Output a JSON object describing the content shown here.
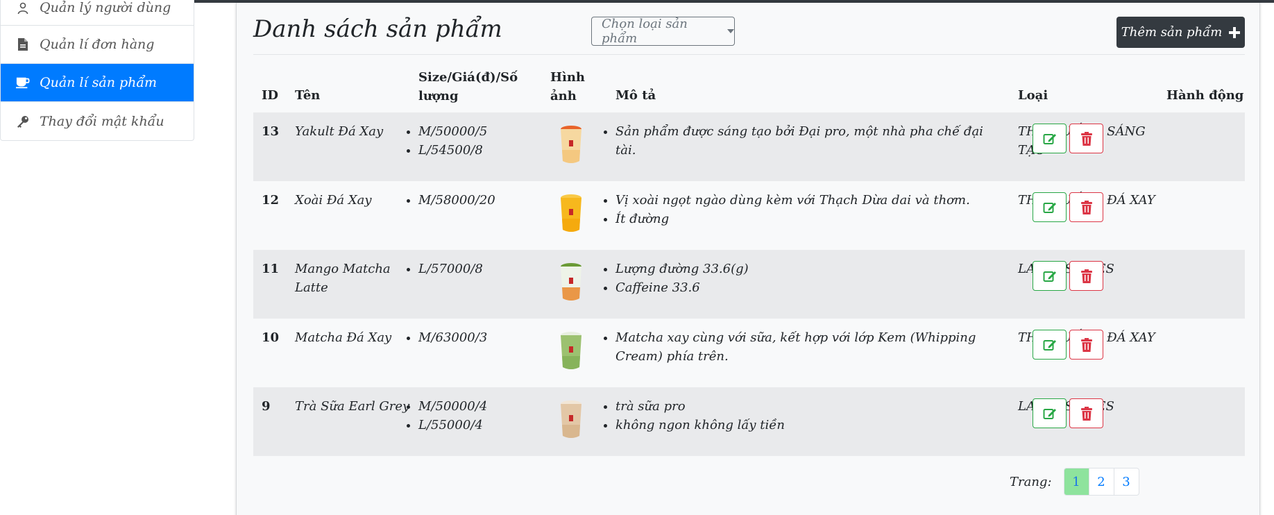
{
  "sidebar": {
    "items": [
      {
        "label": "Quản lý người dùng",
        "icon": "user-icon"
      },
      {
        "label": "Quản lí đơn hàng",
        "icon": "file-icon"
      },
      {
        "label": "Quản lí sản phẩm",
        "icon": "coffee-cup-icon"
      },
      {
        "label": "Thay đổi mật khẩu",
        "icon": "key-icon"
      }
    ]
  },
  "main": {
    "title": "Danh sách sản phẩm",
    "category_placeholder": "Chọn loại sản phẩm",
    "add_button_label": "Thêm sản phẩm"
  },
  "table": {
    "headers": {
      "id": "ID",
      "name": "Tên",
      "size_line1": "Size/Giá(đ)/Số",
      "size_line2": "lượng",
      "image_line1": "Hình",
      "image_line2": "ảnh",
      "description": "Mô tả",
      "category": "Loại",
      "actions": "Hành động"
    },
    "rows": [
      {
        "id": "13",
        "name": "Yakult Đá Xay",
        "sizes": [
          "M/50000/5",
          "L/54500/8"
        ],
        "desc": [
          "Sản phẩm được sáng tạo bởi Đại pro, một nhà pha chế đại tài."
        ],
        "category": "THỨC UỐNG SÁNG TẠO",
        "drink": "yakult"
      },
      {
        "id": "12",
        "name": "Xoài Đá Xay",
        "sizes": [
          "M/58000/20"
        ],
        "desc": [
          "Vị xoài ngọt ngào dùng kèm với Thạch Dừa dai và thơm.",
          "Ít đường"
        ],
        "category": "THỨC UỐNG ĐÁ XAY",
        "drink": "mango"
      },
      {
        "id": "11",
        "name": "Mango Matcha Latte",
        "sizes": [
          "L/57000/8"
        ],
        "desc": [
          "Lượng đường 33.6(g)",
          "Caffeine 33.6"
        ],
        "category": "LATTE SERIES",
        "drink": "mango-matcha"
      },
      {
        "id": "10",
        "name": "Matcha Đá Xay",
        "sizes": [
          "M/63000/3"
        ],
        "desc": [
          "Matcha xay cùng với sữa, kết hợp với lớp Kem (Whipping Cream) phía trên."
        ],
        "category": "THỨC UỐNG ĐÁ XAY",
        "drink": "matcha"
      },
      {
        "id": "9",
        "name": "Trà Sữa Earl Grey",
        "sizes": [
          "M/50000/4",
          "L/55000/4"
        ],
        "desc": [
          "trà sữa pro",
          "không ngon không lấy tiền"
        ],
        "category": "LATTE SERIES",
        "drink": "earl-grey"
      }
    ]
  },
  "pagination": {
    "label": "Trang:",
    "pages": [
      "1",
      "2",
      "3"
    ],
    "current": "1"
  },
  "colors": {
    "active_sidebar": "#007bff",
    "dark_button": "#343a40",
    "edit": "#28a745",
    "delete": "#dc3545",
    "active_page": "#8ee39d"
  }
}
